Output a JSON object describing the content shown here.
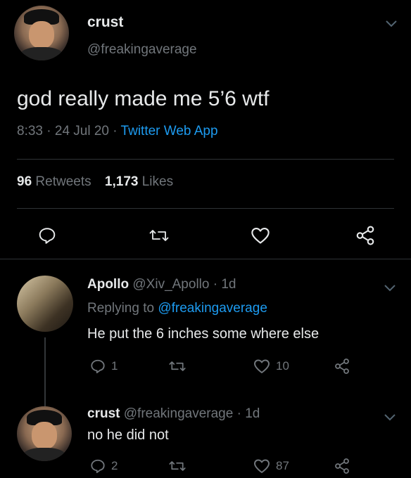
{
  "main_tweet": {
    "display_name": "crust",
    "handle": "@freakingaverage",
    "text": "god really made me 5’6 wtf",
    "time": "8:33",
    "dot1": "·",
    "date": "24 Jul 20",
    "dot2": "·",
    "source": "Twitter Web App",
    "retweets_count": "96",
    "retweets_label": "Retweets",
    "likes_count": "1,173",
    "likes_label": "Likes"
  },
  "replies": [
    {
      "display_name": "Apollo",
      "handle": "@Xiv_Apollo",
      "dot": "·",
      "age": "1d",
      "replying_prefix": "Replying to",
      "replying_handle": "@freakingaverage",
      "text": "He put the 6 inches some where else",
      "reply_count": "1",
      "like_count": "10"
    },
    {
      "display_name": "crust",
      "handle": "@freakingaverage",
      "dot": "·",
      "age": "1d",
      "text": "no he did not",
      "reply_count": "2",
      "like_count": "87"
    }
  ],
  "colors": {
    "background": "#000000",
    "text": "#e7e9ea",
    "muted": "#71767b",
    "accent": "#1d9bf0",
    "separator": "#2f3336"
  },
  "icons": [
    "chevron-down-icon",
    "reply-icon",
    "retweet-icon",
    "like-icon",
    "share-icon"
  ]
}
